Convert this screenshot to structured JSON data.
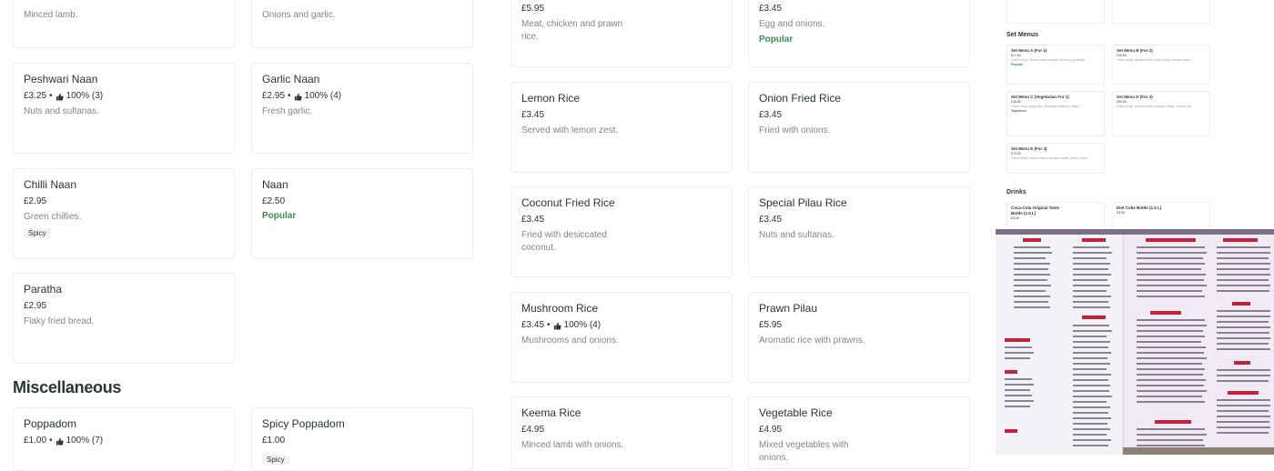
{
  "partial_top": {
    "left1_desc": "Minced lamb.",
    "left2_desc": "Onions and garlic.",
    "mid1_price": "£5.95",
    "mid1_desc": "Meat, chicken and prawn rice.",
    "mid2_price": "£3.45",
    "mid2_desc": "Egg and onions.",
    "mid2_popular": "Popular"
  },
  "breads": [
    {
      "name": "Peshwari Naan",
      "price": "£3.25",
      "rating": "100% (3)",
      "desc": "Nuts and sultanas."
    },
    {
      "name": "Garlic Naan",
      "price": "£2.95",
      "rating": "100% (4)",
      "desc": "Fresh garlic."
    },
    {
      "name": "Chilli Naan",
      "price": "£2.95",
      "desc": "Green chillies.",
      "tag": "Spicy"
    },
    {
      "name": "Naan",
      "price": "£2.50",
      "popular": "Popular"
    },
    {
      "name": "Paratha",
      "price": "£2.95",
      "desc": "Flaky fried bread."
    }
  ],
  "misc_heading": "Miscellaneous",
  "misc": [
    {
      "name": "Poppadom",
      "price": "£1.00",
      "rating": "100% (7)"
    },
    {
      "name": "Spicy Poppadom",
      "price": "£1.00",
      "tag": "Spicy"
    }
  ],
  "rice": [
    {
      "name": "Lemon Rice",
      "price": "£3.45",
      "desc": "Served with lemon zest."
    },
    {
      "name": "Onion Fried Rice",
      "price": "£3.45",
      "desc": "Fried with onions."
    },
    {
      "name": "Coconut Fried Rice",
      "price": "£3.45",
      "desc": "Fried with desiccated coconut."
    },
    {
      "name": "Special Pilau Rice",
      "price": "£3.45",
      "desc": "Nuts and sultanas."
    },
    {
      "name": "Mushroom Rice",
      "price": "£3.45",
      "rating": "100% (4)",
      "desc": "Mushrooms and onions."
    },
    {
      "name": "Prawn Pilau",
      "price": "£5.95",
      "desc": "Aromatic rice with prawns."
    },
    {
      "name": "Keema Rice",
      "price": "£4.95",
      "desc": "Minced lamb with onions."
    },
    {
      "name": "Vegetable Rice",
      "price": "£4.95",
      "desc": "Mixed vegetables with onions."
    }
  ],
  "panel": {
    "set_menus_heading": "Set Menus",
    "set_menus": [
      {
        "name": "Set Menu A (For 1)",
        "price": "£17.60",
        "desc": "Onion bhaji, chicken tikka masala, Bombay potatoes...",
        "popular": "Popular"
      },
      {
        "name": "Set Menu B (For 2)",
        "price": "£33.50",
        "desc": "Onion bhaji, chicken tikka, onion bhaji, keema, lamb..."
      },
      {
        "name": "Set Menu C (Vegetarian For 1)",
        "price": "£18.60",
        "desc": "Onion bhaji, saag aloo, Bombay potatoes, pilau ri...",
        "tag": "Vegetarian"
      },
      {
        "name": "Set Menu D (For 3)",
        "price": "£50.50",
        "desc": "Onion bhaji, chicken tikka, chicken chaat, chicken tik..."
      },
      {
        "name": "Set Menu E (For 4)",
        "price": "£72.00",
        "desc": "Onion bhaji, chicken tikka, chicken chaat, seekh keba..."
      }
    ],
    "drinks_heading": "Drinks",
    "drinks": [
      {
        "name": "Coca-Cola Original Taste Bottle (1.5 L)",
        "price": "£3.25"
      },
      {
        "name": "Diet Coke Bottle (1.5 L)",
        "price": "£3.25"
      }
    ],
    "photo_alt": "Menu photo"
  },
  "colors": {
    "text": "#2e3333",
    "muted": "#828585",
    "popular": "#3c8a4e",
    "border": "#eceeee"
  }
}
